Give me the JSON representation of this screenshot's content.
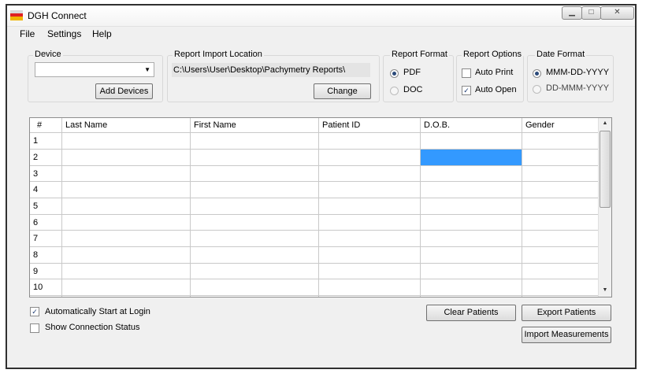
{
  "window": {
    "title": "DGH Connect",
    "controls": [
      "▁",
      "□",
      "✕"
    ]
  },
  "menu": [
    "File",
    "Settings",
    "Help"
  ],
  "device": {
    "label": "Device",
    "selected": "",
    "add_button": "Add Devices"
  },
  "import_location": {
    "label": "Report Import Location",
    "path": "C:\\Users\\User\\Desktop\\Pachymetry Reports\\",
    "change_button": "Change"
  },
  "report_format": {
    "label": "Report Format",
    "options": [
      {
        "label": "PDF",
        "selected": true
      },
      {
        "label": "DOC",
        "selected": false
      }
    ]
  },
  "report_options": {
    "label": "Report Options",
    "options": [
      {
        "label": "Auto Print",
        "checked": false
      },
      {
        "label": "Auto Open",
        "checked": true
      }
    ]
  },
  "date_format": {
    "label": "Date Format",
    "options": [
      {
        "label": "MMM-DD-YYYY",
        "selected": true
      },
      {
        "label": "DD-MMM-YYYY",
        "selected": false
      }
    ]
  },
  "table": {
    "columns": [
      "#",
      "Last Name",
      "First Name",
      "Patient ID",
      "D.O.B.",
      "Gender"
    ],
    "rows": [
      "1",
      "2",
      "3",
      "4",
      "5",
      "6",
      "7",
      "8",
      "9",
      "10"
    ],
    "selected_row": 2,
    "selected_column": "D.O.B.",
    "selection_color": "#3399ff"
  },
  "footer": {
    "auto_start": {
      "label": "Automatically Start at Login",
      "checked": true
    },
    "show_status": {
      "label": "Show Connection Status",
      "checked": false
    },
    "clear_button": "Clear Patients",
    "export_button": "Export Patients",
    "import_button": "Import Measurements"
  }
}
